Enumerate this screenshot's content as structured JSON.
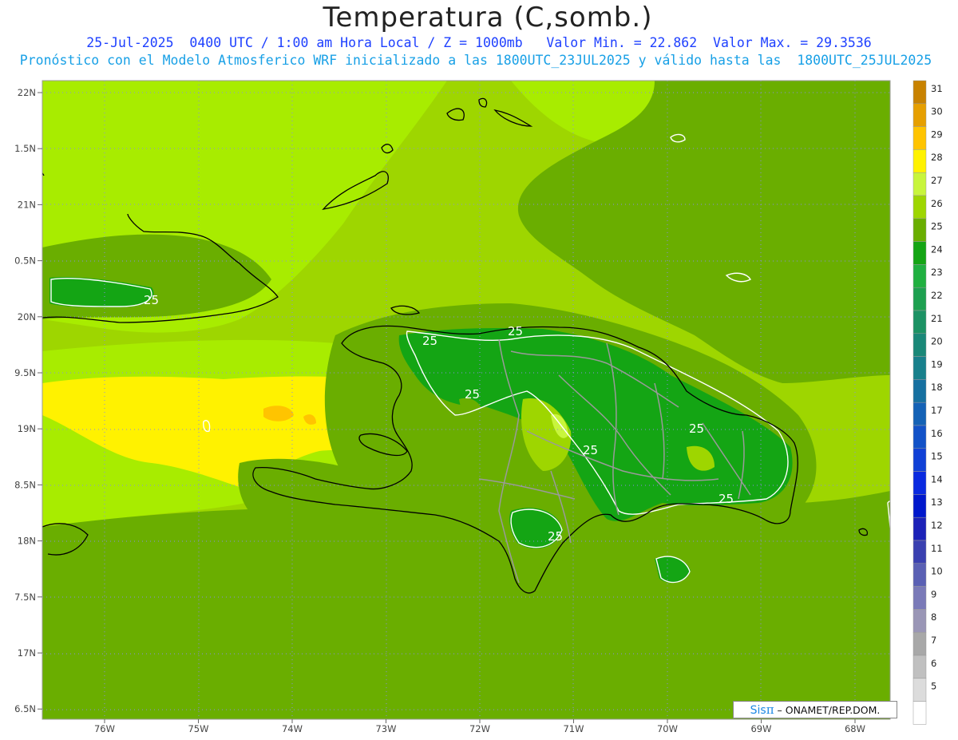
{
  "header": {
    "title": "Temperatura (C,somb.)",
    "subtitle_line1": "25-Jul-2025  0400 UTC / 1:00 am Hora Local / Z = 1000mb   Valor Min. = 22.862  Valor Max. = 29.3536",
    "subtitle_line2": "Pronóstico con el Modelo Atmosferico WRF inicializado a las 1800UTC_23JUL2025 y válido hasta las  1800UTC_25JUL2025"
  },
  "axes": {
    "lat_labels": [
      "22N",
      "1.5N",
      "21N",
      "0.5N",
      "20N",
      "9.5N",
      "19N",
      "8.5N",
      "18N",
      "7.5N",
      "17N",
      "6.5N"
    ],
    "lon_labels": [
      "76W",
      "75W",
      "74W",
      "73W",
      "72W",
      "71W",
      "70W",
      "69W",
      "68W"
    ]
  },
  "map": {
    "contour_value_labels": [
      "25",
      "25",
      "25",
      "25",
      "25",
      "25",
      "25",
      "25"
    ]
  },
  "colorbar": {
    "levels": [
      {
        "value": "31",
        "color": "#c88200"
      },
      {
        "value": "30",
        "color": "#e69f00"
      },
      {
        "value": "29",
        "color": "#ffc400"
      },
      {
        "value": "28",
        "color": "#fff200"
      },
      {
        "value": "27",
        "color": "#c8f53c"
      },
      {
        "value": "26",
        "color": "#9ed600"
      },
      {
        "value": "25",
        "color": "#6aae00"
      },
      {
        "value": "24",
        "color": "#14a514"
      },
      {
        "value": "23",
        "color": "#20b040"
      },
      {
        "value": "22",
        "color": "#1ea050"
      },
      {
        "value": "21",
        "color": "#1c9264"
      },
      {
        "value": "20",
        "color": "#1a8878"
      },
      {
        "value": "19",
        "color": "#18808c"
      },
      {
        "value": "18",
        "color": "#1670a0"
      },
      {
        "value": "17",
        "color": "#1462b6"
      },
      {
        "value": "16",
        "color": "#1252c8"
      },
      {
        "value": "15",
        "color": "#1040d6"
      },
      {
        "value": "14",
        "color": "#0a2ae0"
      },
      {
        "value": "13",
        "color": "#0018cc"
      },
      {
        "value": "12",
        "color": "#1c22b8"
      },
      {
        "value": "11",
        "color": "#3a40b0"
      },
      {
        "value": "10",
        "color": "#5a60b4"
      },
      {
        "value": "9",
        "color": "#7a7ab8"
      },
      {
        "value": "8",
        "color": "#9a96b6"
      },
      {
        "value": "7",
        "color": "#a8a8a8"
      },
      {
        "value": "6",
        "color": "#c0c0c0"
      },
      {
        "value": "5",
        "color": "#dcdcdc"
      },
      {
        "value": "",
        "color": "#ffffff"
      }
    ]
  },
  "credit": {
    "brand": "Sis",
    "pi": "π",
    "text": " – ONAMET/REP.DOM."
  }
}
